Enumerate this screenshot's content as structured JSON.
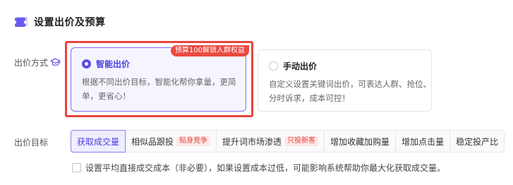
{
  "header": {
    "title": "设置出价及预算",
    "icon": "ticket-icon"
  },
  "bid_method": {
    "label": "出价方式",
    "help_icon": "graduation-cap-icon",
    "options": [
      {
        "title": "智能出价",
        "desc": "根据不同出价目标，智能化帮你拿量，更简单，更省心！",
        "selected": true,
        "badge": "预算100解锁人群权益"
      },
      {
        "title": "手动出价",
        "desc": "自定义设置关键词出价，可表达人群、抢位、分时诉求，成本可控！",
        "selected": false
      }
    ]
  },
  "bid_goal": {
    "label": "出价目标",
    "tabs": [
      {
        "label": "获取成交量",
        "active": true
      },
      {
        "label": "相似品跟投",
        "badge": "贴身竞争"
      },
      {
        "label": "提升词市场渗透",
        "badge": "只投新客"
      },
      {
        "label": "增加收藏加购量"
      },
      {
        "label": "增加点击量"
      },
      {
        "label": "稳定投产比"
      }
    ]
  },
  "avg_cost": {
    "text": "设置平均直接成交成本（非必要），如果设置成本过低，可能影响系统帮助你最大化获取成交量。",
    "checked": false
  },
  "colors": {
    "accent": "#5b4ce8",
    "highlight_frame": "#e8443c",
    "badge_red": "#ea4a41"
  }
}
